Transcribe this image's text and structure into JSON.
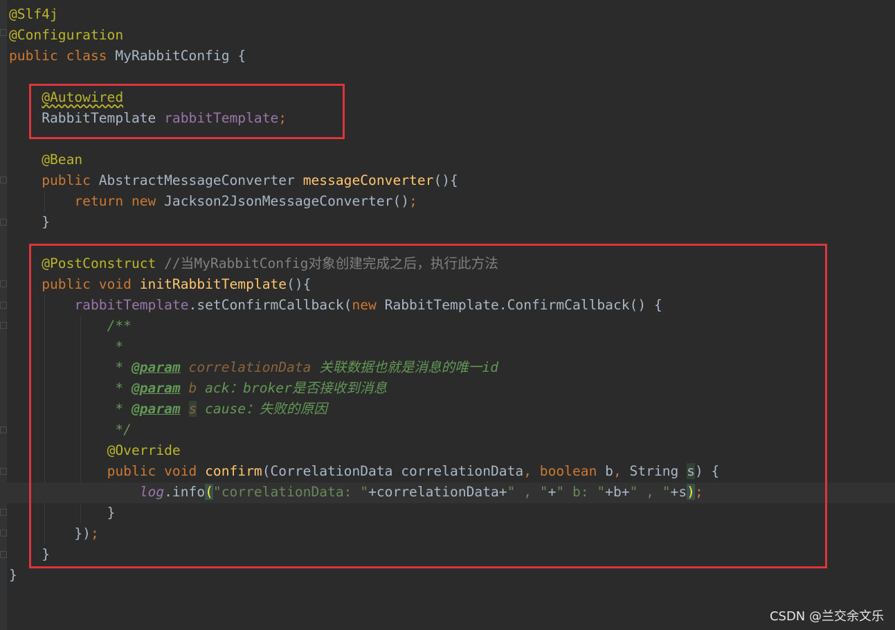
{
  "code": {
    "l1": {
      "ann": "@Slf4j"
    },
    "l2": {
      "ann": "@Configuration"
    },
    "l3": {
      "kw1": "public",
      "kw2": "class",
      "name": "MyRabbitConfig",
      "brace": "{"
    },
    "l4": {
      "ann": "@Autowired"
    },
    "l5": {
      "type": "RabbitTemplate",
      "field": "rabbitTemplate",
      "semi": ";"
    },
    "l6": {
      "ann": "@Bean"
    },
    "l7": {
      "kw": "public",
      "type": "AbstractMessageConverter",
      "method": "messageConverter",
      "rest": "(){"
    },
    "l8": {
      "kw1": "return",
      "kw2": "new",
      "call": "Jackson2JsonMessageConverter()",
      "semi": ";"
    },
    "l9": {
      "brace": "}"
    },
    "l10": {
      "ann": "@PostConstruct",
      "comment": "//当MyRabbitConfig对象创建完成之后，执行此方法"
    },
    "l11": {
      "kw1": "public",
      "kw2": "void",
      "method": "initRabbitTemplate",
      "rest": "(){"
    },
    "l12": {
      "field": "rabbitTemplate",
      "call": ".setConfirmCallback(",
      "kw": "new",
      "rest": "RabbitTemplate.ConfirmCallback() {"
    },
    "l13": {
      "doc": "/**"
    },
    "l14": {
      "doc": " *"
    },
    "l15": {
      "star": " * ",
      "tag": "@param",
      "param": "correlationData",
      "desc": " 关联数据也就是消息的唯一id"
    },
    "l16": {
      "star": " * ",
      "tag": "@param",
      "param": "b",
      "desc": " ack：broker是否接收到消息"
    },
    "l17": {
      "star": " * ",
      "tag": "@param",
      "param": "s",
      "desc": " cause：失败的原因"
    },
    "l18": {
      "doc": " */"
    },
    "l19": {
      "ann": "@Override"
    },
    "l20": {
      "kw1": "public",
      "kw2": "void",
      "method": "confirm",
      "p1": "(CorrelationData correlationData",
      "comma1": ",",
      "kw3": "boolean",
      "p2": " b",
      "comma2": ",",
      "p3": " String ",
      "s": "s",
      "rest": ") {"
    },
    "l21": {
      "log": "log",
      "call": ".info",
      "open": "(",
      "str1": "\"correlationData: \"",
      "plus1": "+correlationData+",
      "str2": "\" , \"",
      "plus2": "+",
      "str3": "\" b: \"",
      "plus3": "+b+",
      "str4": "\" , \"",
      "plus4": "+s",
      "close": ")",
      "semi": ";"
    },
    "l22": {
      "brace": "}"
    },
    "l23": {
      "text": "})",
      "semi": ";"
    },
    "l24": {
      "brace": "}"
    },
    "l25": {
      "brace": "}"
    }
  },
  "watermark": "CSDN @兰交余文乐",
  "colors": {
    "background": "#2b2b2b",
    "keyword": "#cc7832",
    "annotation": "#bbb529",
    "method": "#ffc66d",
    "field": "#9876aa",
    "javadoc": "#629755",
    "string": "#6a8759",
    "highlight_box": "#e0343b"
  }
}
